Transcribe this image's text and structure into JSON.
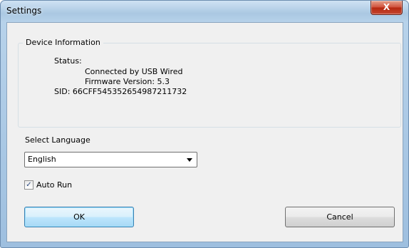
{
  "window": {
    "title": "Settings",
    "close_glyph": "X"
  },
  "device_info": {
    "group_label": "Device Information",
    "status_label": "Status:",
    "connection": "Connected by USB Wired",
    "firmware": "Firmware Version: 5.3",
    "sid": "SID: 66CFF545352654987211732"
  },
  "language": {
    "label": "Select Language",
    "selected": "English"
  },
  "auto_run": {
    "label": "Auto Run",
    "checked": true,
    "check_glyph": "✓"
  },
  "buttons": {
    "ok": "OK",
    "cancel": "Cancel"
  },
  "colors": {
    "accent": "#3c7fb1",
    "close": "#c44731"
  }
}
